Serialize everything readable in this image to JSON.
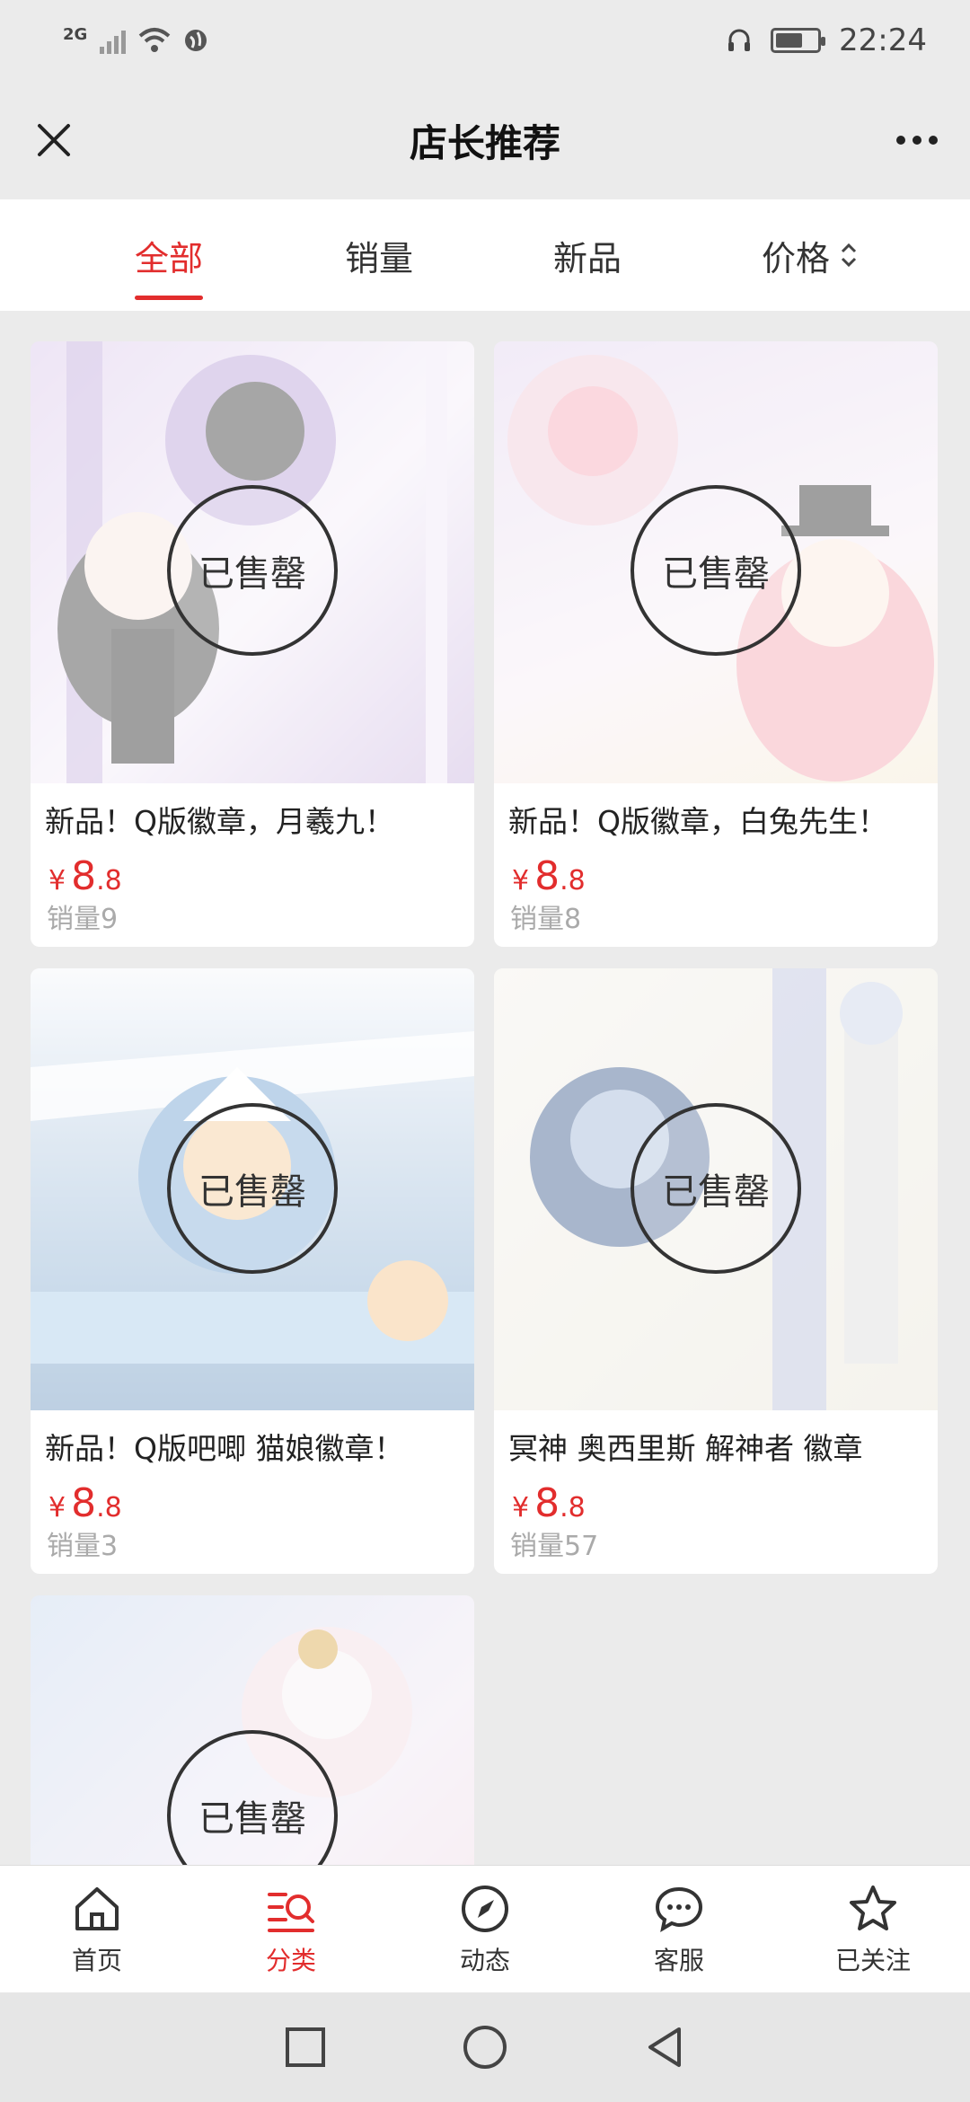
{
  "status_bar": {
    "network": "2G",
    "time": "22:24"
  },
  "header": {
    "title": "店长推荐"
  },
  "tabs": [
    {
      "label": "全部"
    },
    {
      "label": "销量"
    },
    {
      "label": "新品"
    },
    {
      "label": "价格"
    }
  ],
  "products": [
    {
      "name": "新品！Q版徽章，月羲九！",
      "currency": "¥",
      "price_int": "8",
      "price_dec": ".8",
      "sales": "销量9",
      "stamp": "已售罄",
      "bg_color": "#d9c6ea"
    },
    {
      "name": "新品！Q版徽章，白兔先生！",
      "currency": "¥",
      "price_int": "8",
      "price_dec": ".8",
      "sales": "销量8",
      "stamp": "已售罄",
      "bg_color": "#f2e6f0"
    },
    {
      "name": "新品！Q版吧唧 猫娘徽章！",
      "currency": "¥",
      "price_int": "8",
      "price_dec": ".8",
      "sales": "销量3",
      "stamp": "已售罄",
      "bg_color": "#aac2dc"
    },
    {
      "name": "冥神 奥西里斯 解神者 徽章",
      "currency": "¥",
      "price_int": "8",
      "price_dec": ".8",
      "sales": "销量57",
      "stamp": "已售罄",
      "bg_color": "#efece4"
    },
    {
      "name": "",
      "currency": "",
      "price_int": "",
      "price_dec": "",
      "sales": "",
      "stamp": "已售罄",
      "bg_color": "#e9e1ee"
    }
  ],
  "bottom_nav": [
    {
      "label": "首页",
      "icon": "home-icon"
    },
    {
      "label": "分类",
      "icon": "category-search-icon"
    },
    {
      "label": "动态",
      "icon": "compass-icon"
    },
    {
      "label": "客服",
      "icon": "chat-icon"
    },
    {
      "label": "已关注",
      "icon": "star-icon"
    }
  ],
  "colors": {
    "accent": "#e22d2d",
    "background": "#ebebeb"
  }
}
